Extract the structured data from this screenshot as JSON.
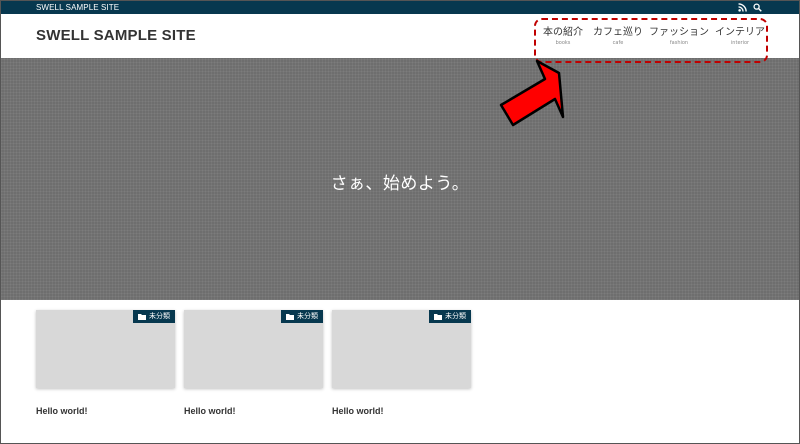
{
  "topbar": {
    "tagline": "SWELL SAMPLE SITE",
    "icons": [
      "rss-icon",
      "search-icon"
    ]
  },
  "header": {
    "logo": "SWELL SAMPLE SITE"
  },
  "nav": {
    "items": [
      {
        "label": "本の紹介",
        "sub": "books"
      },
      {
        "label": "カフェ巡り",
        "sub": "cafe"
      },
      {
        "label": "ファッション",
        "sub": "fashion"
      },
      {
        "label": "インテリア",
        "sub": "interior"
      }
    ]
  },
  "hero": {
    "message": "さぁ、始めよう。"
  },
  "posts": [
    {
      "category": "未分類",
      "title": "Hello world!"
    },
    {
      "category": "未分類",
      "title": "Hello world!"
    },
    {
      "category": "未分類",
      "title": "Hello world!"
    }
  ],
  "colors": {
    "brand": "#07384f",
    "hero_bg": "#6e6e6e",
    "annotation": "#ff0000",
    "highlight_border": "#c00000"
  }
}
